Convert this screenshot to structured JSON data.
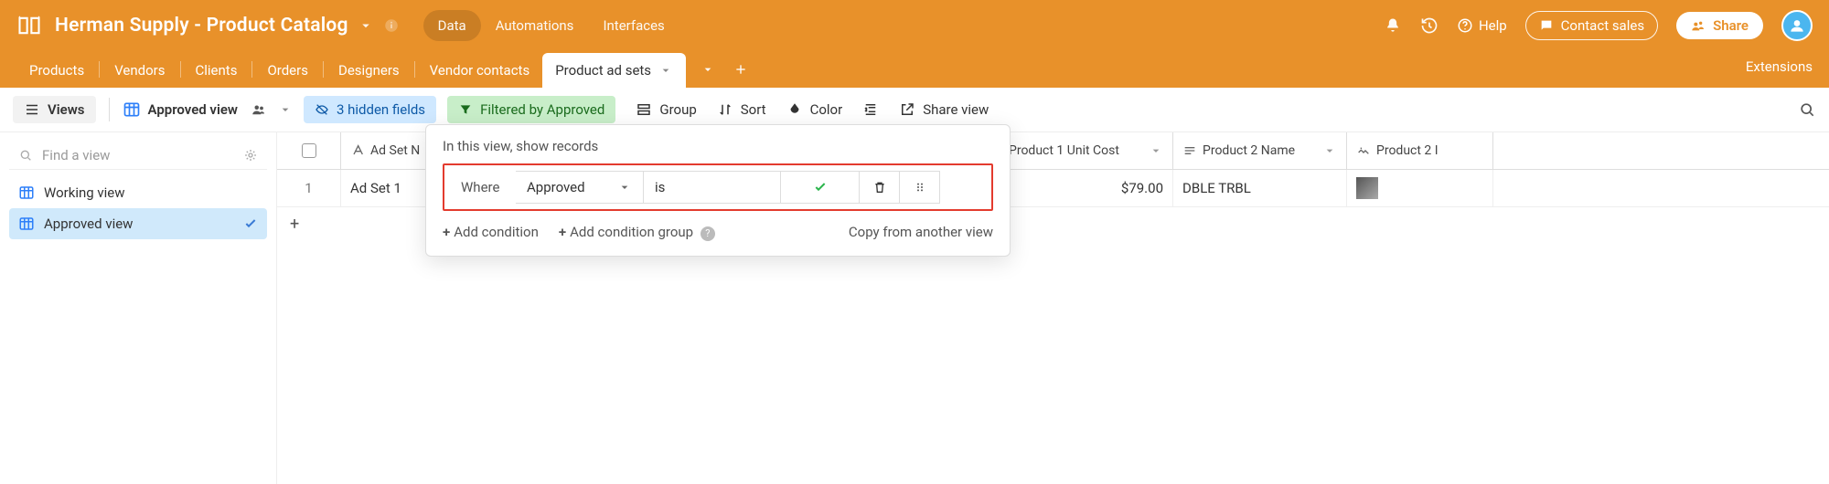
{
  "header": {
    "base_title": "Herman Supply - Product Catalog",
    "nav": {
      "data": "Data",
      "automations": "Automations",
      "interfaces": "Interfaces"
    },
    "help": "Help",
    "contact": "Contact sales",
    "share": "Share"
  },
  "tables": {
    "tabs": [
      "Products",
      "Vendors",
      "Clients",
      "Orders",
      "Designers",
      "Vendor contacts"
    ],
    "active": "Product ad sets",
    "extensions": "Extensions"
  },
  "toolbar": {
    "views": "Views",
    "current_view": "Approved view",
    "hidden_fields": "3 hidden fields",
    "filtered": "Filtered by Approved",
    "group": "Group",
    "sort": "Sort",
    "color": "Color",
    "share_view": "Share view"
  },
  "sidebar": {
    "find_placeholder": "Find a view",
    "views": [
      {
        "label": "Working view",
        "selected": false
      },
      {
        "label": "Approved view",
        "selected": true
      }
    ]
  },
  "grid": {
    "columns": {
      "name": "Ad Set N",
      "cost": "Product 1 Unit Cost",
      "p2name": "Product 2 Name",
      "p2img": "Product 2 I"
    },
    "rows": [
      {
        "num": "1",
        "name": "Ad Set 1",
        "cost": "$79.00",
        "p2name": "DBLE TRBL"
      }
    ]
  },
  "filter": {
    "title": "In this view, show records",
    "where": "Where",
    "field": "Approved",
    "op": "is",
    "add_cond": "Add condition",
    "add_group": "Add condition group",
    "copy": "Copy from another view"
  }
}
